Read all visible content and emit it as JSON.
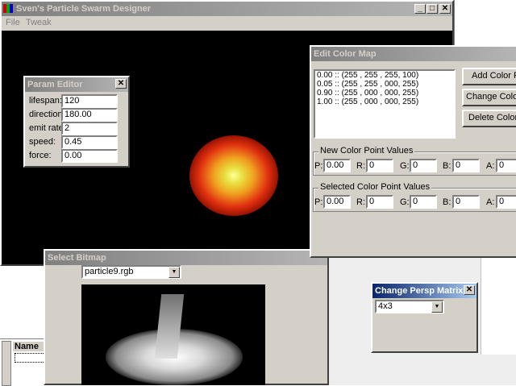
{
  "main_window": {
    "title": "Sven's Particle Swarm Designer",
    "menu": [
      "File",
      "Tweak"
    ],
    "controls": [
      "_",
      "□",
      "✕"
    ]
  },
  "param_editor": {
    "title": "Param Editor",
    "fields": [
      {
        "label": "lifespan:",
        "value": "120"
      },
      {
        "label": "direction:",
        "value": "180.00"
      },
      {
        "label": "emit rate:",
        "value": "2"
      },
      {
        "label": "speed:",
        "value": "0.45"
      },
      {
        "label": "force:",
        "value": "0.00"
      }
    ]
  },
  "color_map": {
    "title": "Edit Color Map",
    "entries": [
      "0.00 :: (255 , 255 , 255, 100)",
      "0.05 :: (255 , 255 , 000, 255)",
      "0.90 :: (255 , 000 , 000, 255)",
      "1.00 :: (255 , 000 , 000, 255)"
    ],
    "buttons": [
      "Add Color Po",
      "Change Color F",
      "Delete Color P"
    ],
    "new_group": {
      "title": "New Color Point Values",
      "fields": [
        {
          "label": "P:",
          "value": "0.00"
        },
        {
          "label": "R:",
          "value": "0"
        },
        {
          "label": "G:",
          "value": "0"
        },
        {
          "label": "B:",
          "value": "0"
        },
        {
          "label": "A:",
          "value": "0"
        }
      ]
    },
    "selected_group": {
      "title": "Selected Color Point Values",
      "fields": [
        {
          "label": "P:",
          "value": "0.00"
        },
        {
          "label": "R:",
          "value": "0"
        },
        {
          "label": "G:",
          "value": "0"
        },
        {
          "label": "B:",
          "value": "0"
        },
        {
          "label": "A:",
          "value": "0"
        }
      ]
    }
  },
  "select_bitmap": {
    "title": "Select Bitmap",
    "selected": "particle9.rgb"
  },
  "persp_matrix": {
    "title": "Change Persp Matrix",
    "selected": "4x3"
  },
  "bottom_panel": {
    "column": "Name"
  },
  "colors": {
    "face": "#d4d0c8",
    "active_title": "#0a246a",
    "inactive_title": "#808080",
    "canvas": "#000000"
  }
}
